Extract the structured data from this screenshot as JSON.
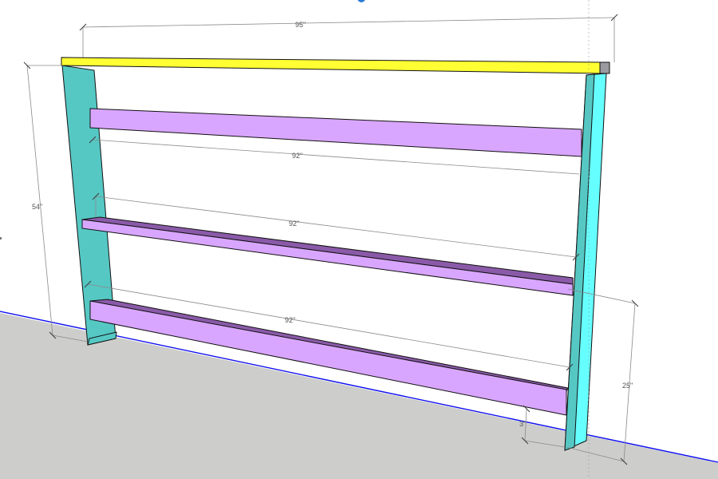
{
  "app": {
    "kind": "3d-model-viewport"
  },
  "colors": {
    "ground": "#cdcdcb",
    "horizon": "#1010ee",
    "top_board": "#ffff33",
    "top_board_end": "#9a9aa0",
    "legs_front": "#55c8c4",
    "legs_side": "#66ffff",
    "rail_face": "#d9a6ff",
    "rail_top": "#8a5aa8",
    "dimension": "#8a8a8a",
    "edge": "#111111"
  },
  "dimensions": {
    "overall_width": "95\"",
    "overall_height": "54\"",
    "rail_top_length": "92\"",
    "rail_middle_length": "92\"",
    "rail_bottom_length": "92\"",
    "bottom_rail_height": "25\"",
    "bottom_rail_gap": "3\""
  }
}
